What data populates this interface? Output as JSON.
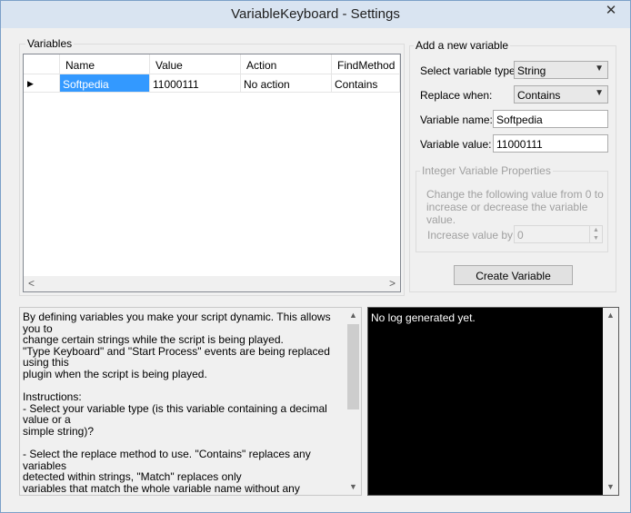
{
  "window": {
    "title": "VariableKeyboard - Settings",
    "close_glyph": "✕"
  },
  "variables": {
    "group_label": "Variables",
    "columns": [
      "Name",
      "Value",
      "Action",
      "FindMethod"
    ],
    "rows": [
      {
        "name": "Softpedia",
        "value": "11000111",
        "action": "No action",
        "find_method": "Contains"
      }
    ],
    "row_indicator": "▶"
  },
  "new_variable": {
    "group_label": "Add a new variable",
    "type_label": "Select variable type:",
    "type_value": "String",
    "replace_label": "Replace when:",
    "replace_value": "Contains",
    "name_label": "Variable name:",
    "name_value": "Softpedia",
    "value_label": "Variable value:",
    "value_value": "11000111",
    "integer_group_label": "Integer Variable Properties",
    "integer_hint": "Change the following value from 0 to increase or decrease the variable value.",
    "increase_label": "Increase value by:",
    "increase_value": "0",
    "create_button": "Create Variable"
  },
  "help_text": "By defining variables you make your script dynamic. This allows you to\nchange certain strings while the script is being played.\n\"Type Keyboard\" and \"Start Process\" events are being replaced using this\nplugin when the script is being played.\n\nInstructions:\n- Select your variable type (is this variable containing a decimal value or a\nsimple string)?\n\n- Select the replace method to use. \"Contains\" replaces any variables\ndetected within strings, \"Match\" replaces only\nvariables that match the whole variable name without any interruptions.\n\"RegularExpression\" replaces variables that match the\nvariable name using Regular Expression!",
  "log": {
    "text": "No log generated yet."
  },
  "colors": {
    "selection": "#3399ff",
    "log_background": "#000000",
    "titlebar": "#d9e4f1"
  }
}
